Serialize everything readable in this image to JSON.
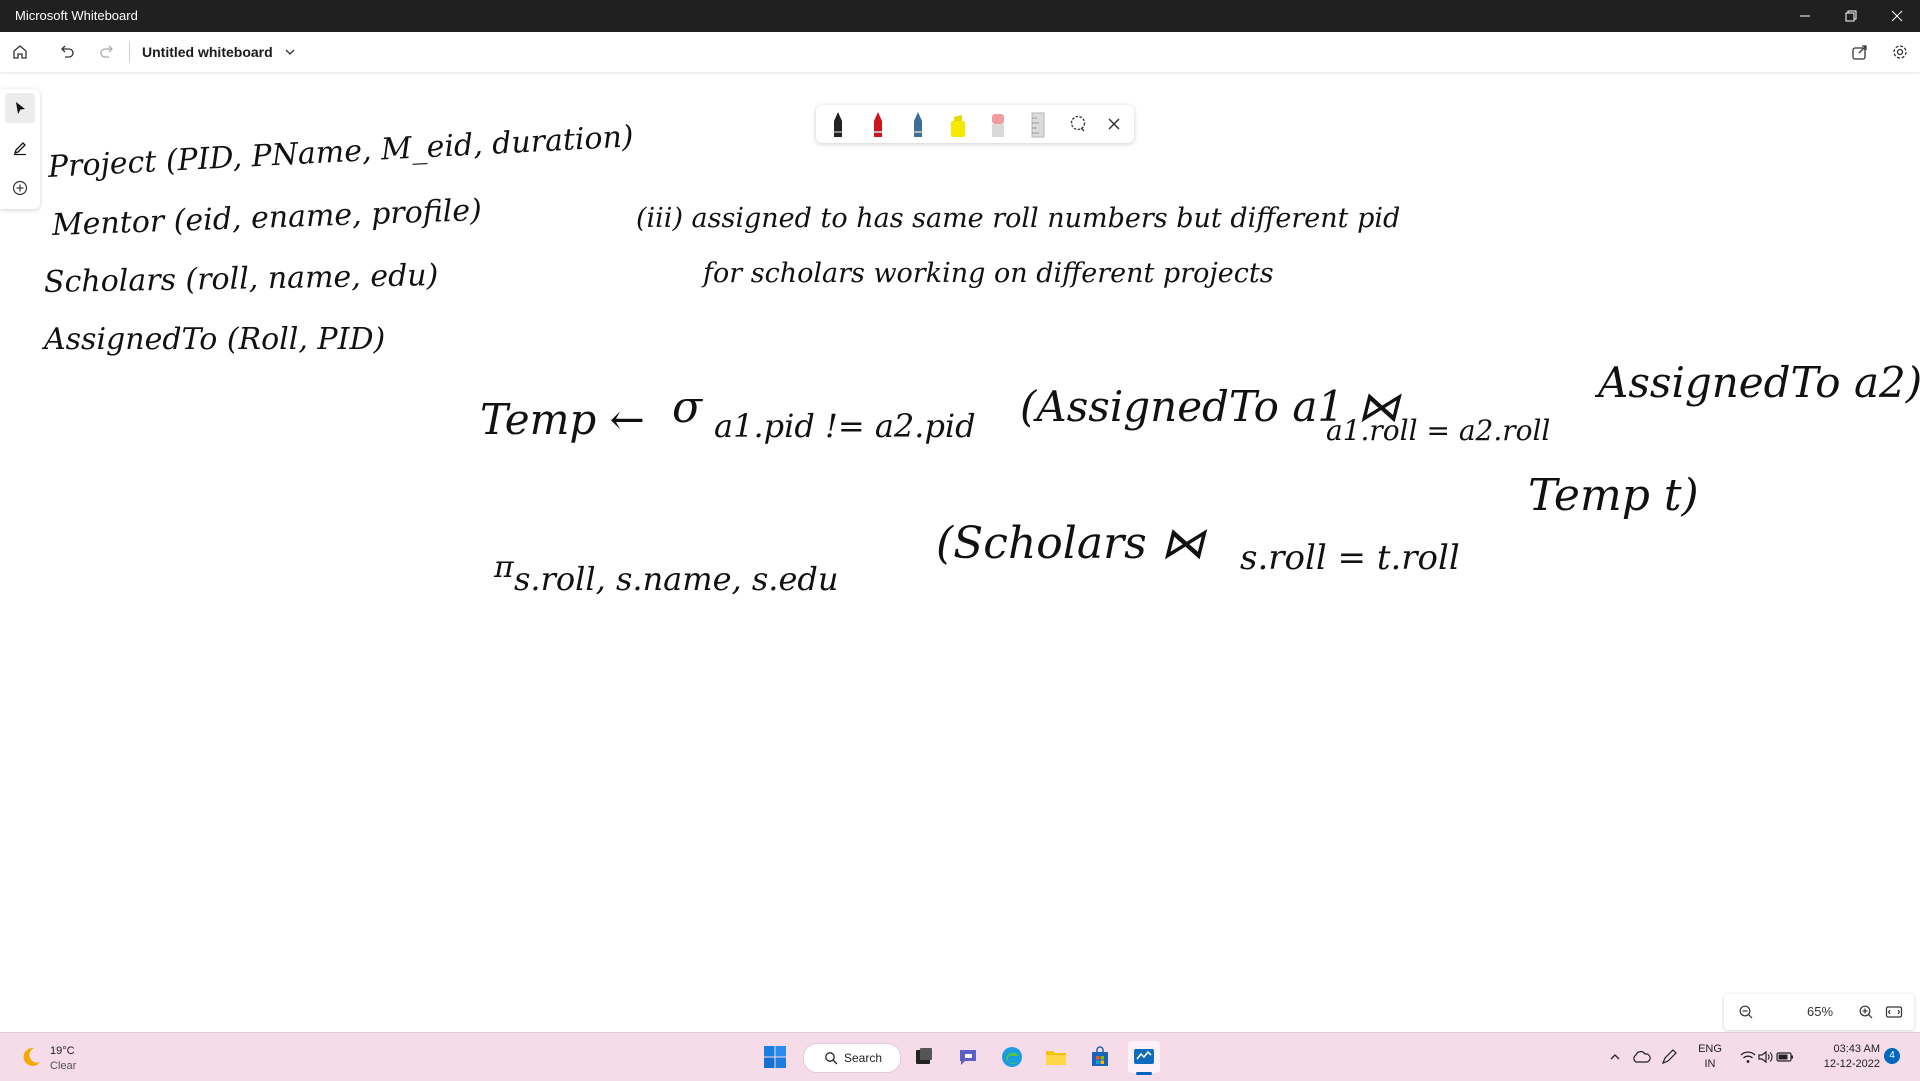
{
  "window": {
    "title": "Microsoft Whiteboard"
  },
  "appbar": {
    "doc_title": "Untitled whiteboard"
  },
  "canvas": {
    "schema_lines": [
      "Project (PID, PName, M_eid, duration)",
      "Mentor (eid, ename, profile)",
      "Scholars (roll, name, edu)",
      "AssignedTo (Roll, PID)"
    ],
    "question_line1": "(iii) assigned to has same roll numbers but different pid",
    "question_line2": "for scholars working on different projects",
    "expr1": {
      "lhs": "Temp ←",
      "sigma": "σ",
      "condition": "a1.pid != a2.pid",
      "body": "(AssignedTo a1 ⋈",
      "join_cond": "a1.roll = a2.roll",
      "tail": "AssignedTo a2)"
    },
    "expr2": {
      "pi": "π",
      "projection": "s.roll, s.name, s.edu",
      "body": "(Scholars ⋈",
      "join_cond": "s.roll = t.roll",
      "tail": "Temp t)"
    }
  },
  "zoom": {
    "value": "65%"
  },
  "taskbar": {
    "weather_temp": "19°C",
    "weather_cond": "Clear",
    "search_label": "Search",
    "lang_top": "ENG",
    "lang_bottom": "IN",
    "time": "03:43 AM",
    "date": "12-12-2022",
    "notif_count": "4"
  },
  "colors": {
    "titlebar": "#202020",
    "taskbar": "#f5dce8",
    "ink": "#111111",
    "accent": "#0067c0"
  }
}
